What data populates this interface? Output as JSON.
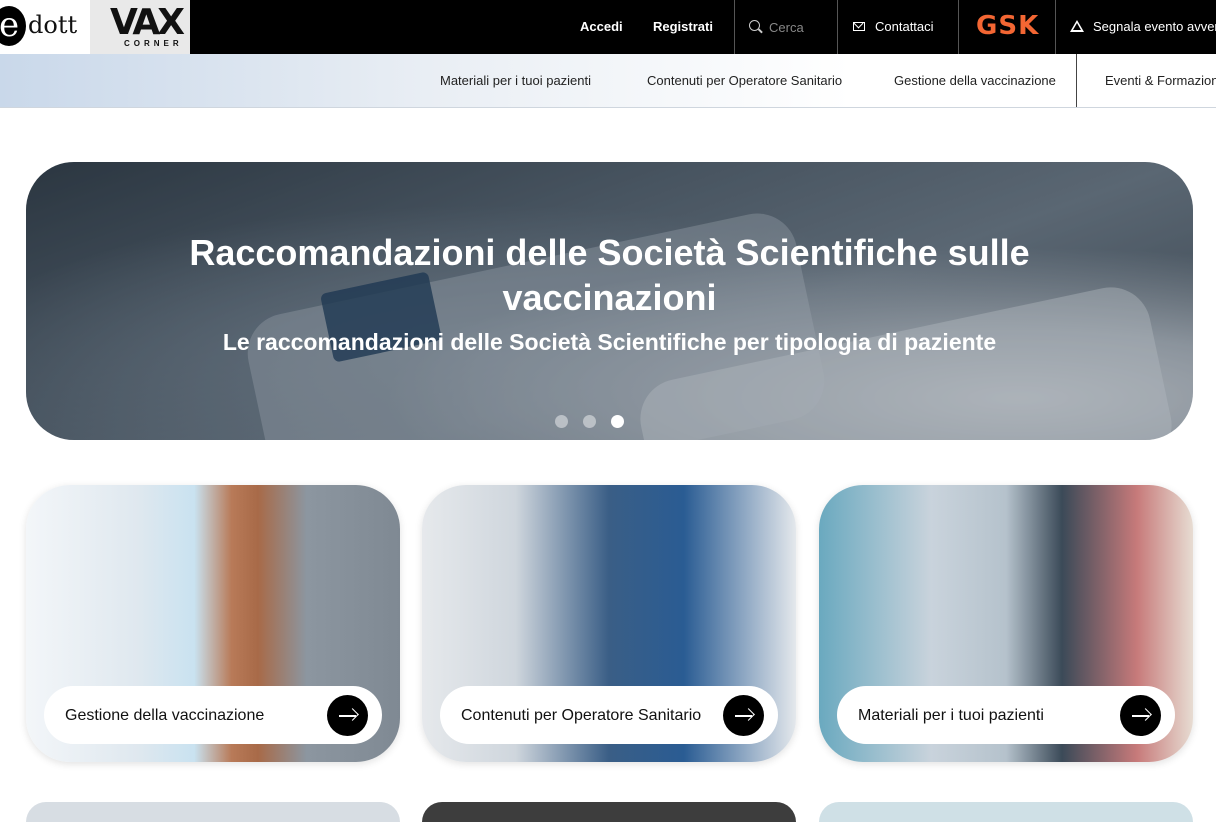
{
  "header": {
    "logo_edott_letter": "e",
    "logo_edott_text": "dott",
    "logo_vax": "VAX",
    "logo_vax_sub": "CORNER",
    "login": "Accedi",
    "register": "Registrati",
    "search_placeholder": "Cerca",
    "contact": "Contattaci",
    "brand": "GSK",
    "report": "Segnala evento avvers"
  },
  "subnav": {
    "items": [
      "Materiali per i tuoi pazienti",
      "Contenuti per Operatore Sanitario",
      "Gestione della vaccinazione",
      "Eventi & Formazione"
    ]
  },
  "hero": {
    "title": "Raccomandazioni delle Società Scientifiche sulle vaccinazioni",
    "subtitle": "Le raccomandazioni delle Società Scientifiche per tipologia di paziente",
    "slides": 3,
    "active_slide": 3
  },
  "cards": [
    {
      "label": "Gestione della vaccinazione"
    },
    {
      "label": "Contenuti per Operatore Sanitario"
    },
    {
      "label": "Materiali per i tuoi pazienti"
    }
  ]
}
